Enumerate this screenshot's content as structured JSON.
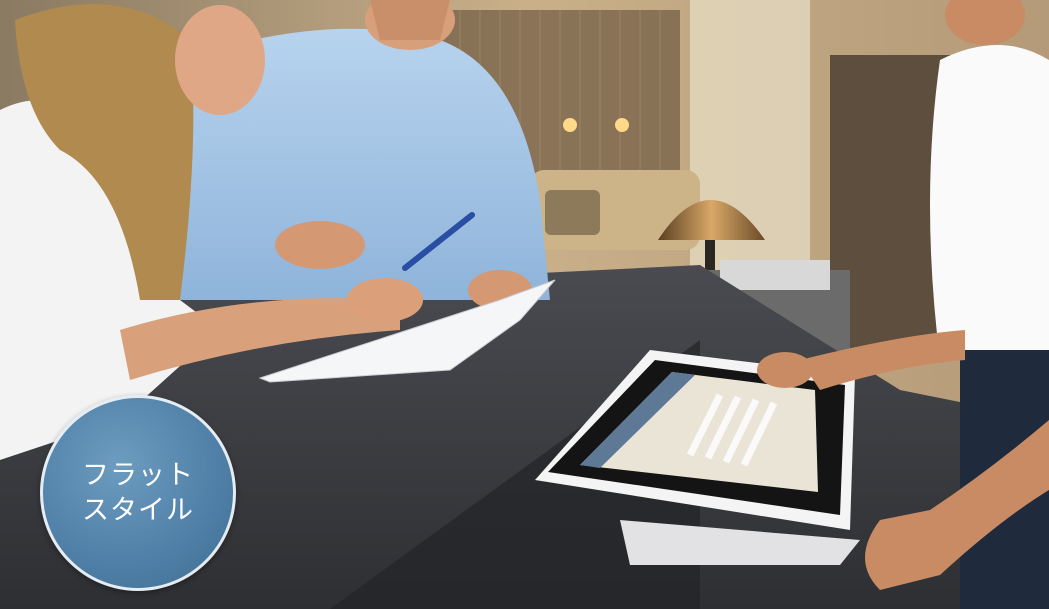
{
  "badge": {
    "line1": "フラット",
    "line2": "スタイル",
    "color": "#4f7fa6"
  },
  "photo": {
    "description_free": true,
    "palette": {
      "counter": "#3a3b3f",
      "wall": "#b79a76",
      "screen": "#e9e4d6"
    }
  }
}
